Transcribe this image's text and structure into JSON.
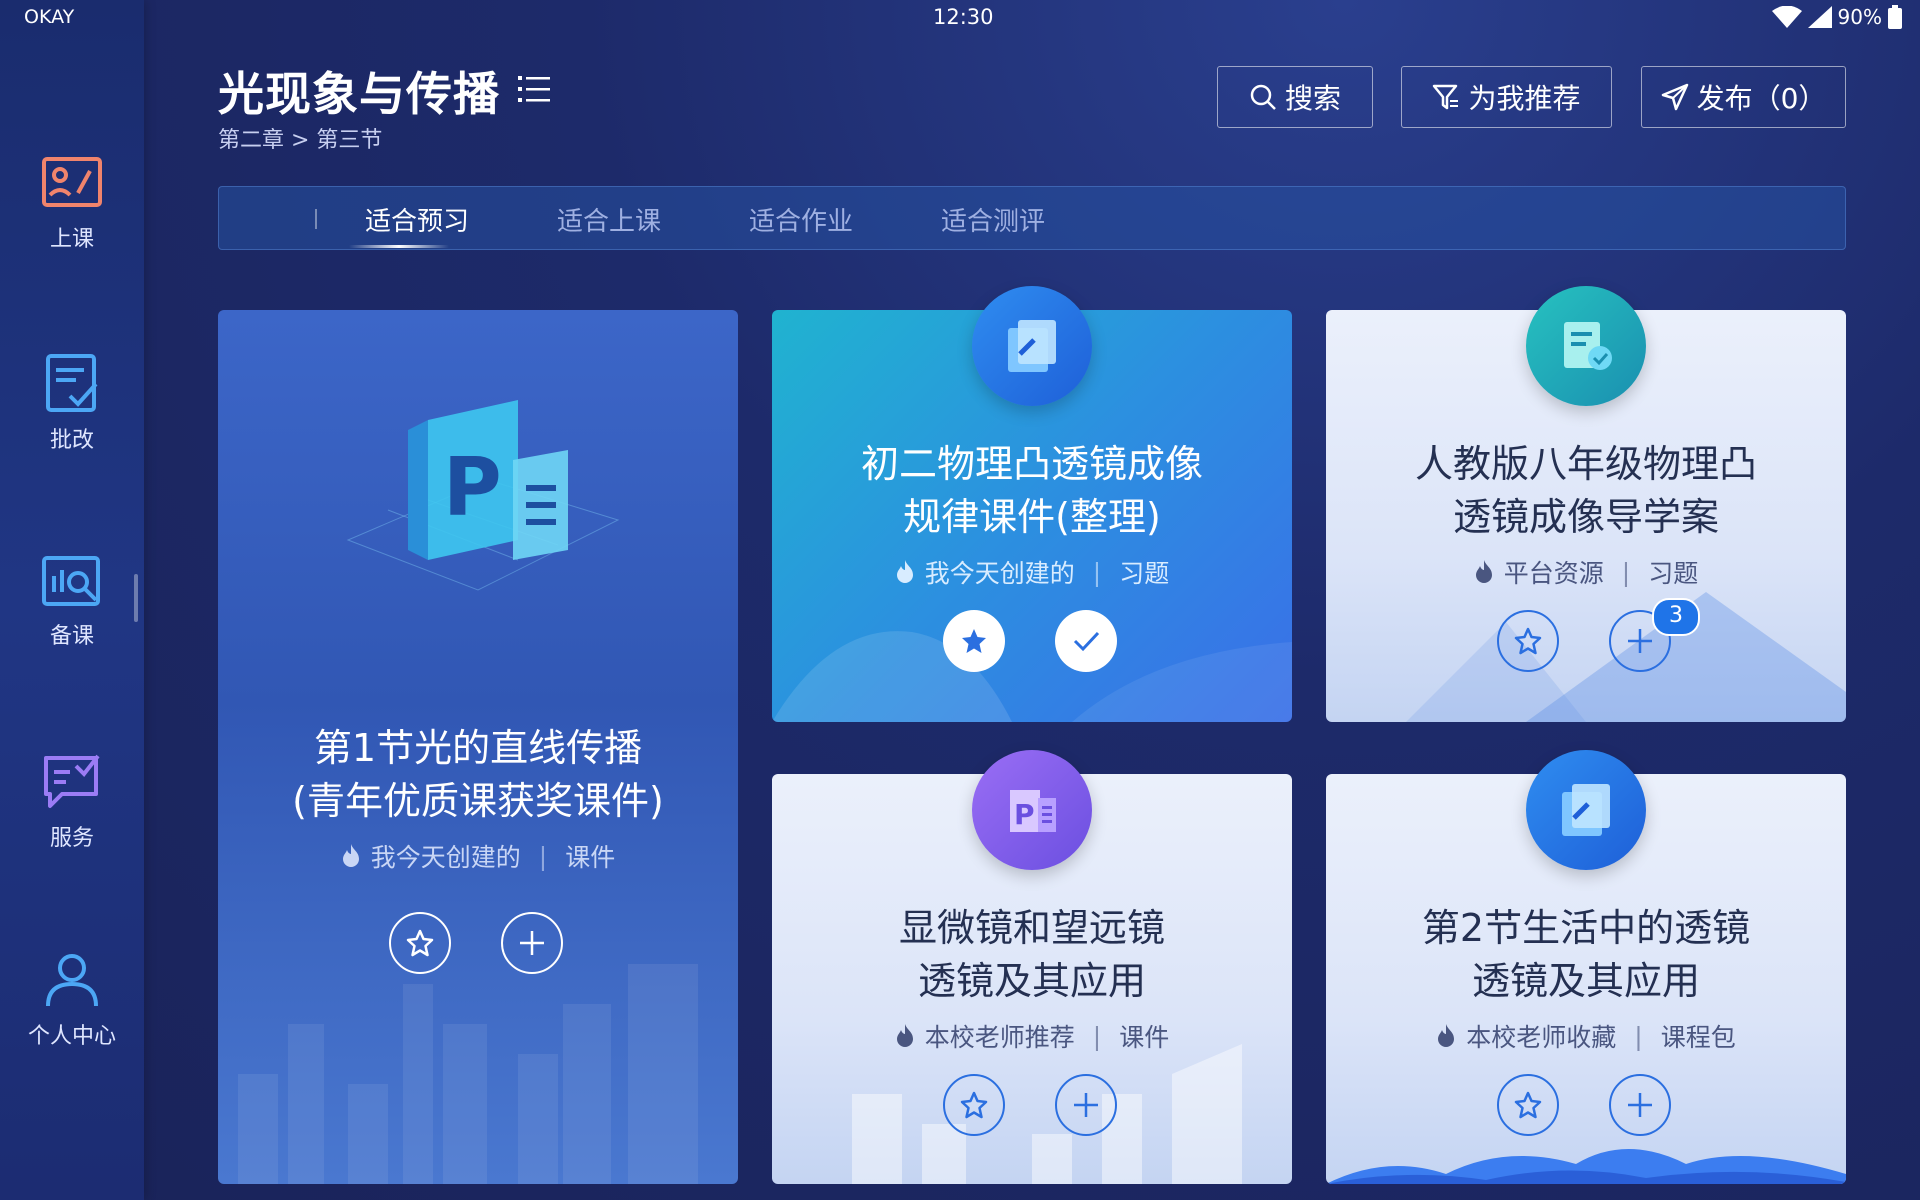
{
  "status_bar": {
    "carrier": "OKAY",
    "time": "12:30",
    "battery": "90%"
  },
  "sidebar": {
    "items": [
      {
        "label": "上课"
      },
      {
        "label": "批改"
      },
      {
        "label": "备课"
      },
      {
        "label": "服务"
      },
      {
        "label": "个人中心"
      }
    ]
  },
  "header": {
    "title": "光现象与传播",
    "breadcrumb": "第二章 > 第三节",
    "search_label": "搜索",
    "recommend_label": "为我推荐",
    "publish_label": "发布（0）"
  },
  "tabs": [
    {
      "label": "适合预习",
      "active": true
    },
    {
      "label": "适合上课",
      "active": false
    },
    {
      "label": "适合作业",
      "active": false
    },
    {
      "label": "适合测评",
      "active": false
    }
  ],
  "cards": [
    {
      "title_line1": "第1节光的直线传播",
      "title_line2": "(青年优质课获奖课件)",
      "source": "我今天创建的",
      "type": "课件",
      "icon": "ppt-document-icon"
    },
    {
      "title_line1": "初二物理凸透镜成像",
      "title_line2": "规律课件(整理)",
      "source": "我今天创建的",
      "type": "习题",
      "icon": "exercise-icon",
      "favorited": true,
      "added": true
    },
    {
      "title_line1": "人教版八年级物理凸",
      "title_line2": "透镜成像导学案",
      "source": "平台资源",
      "type": "习题",
      "icon": "study-guide-icon",
      "badge": "3"
    },
    {
      "title_line1": "显微镜和望远镜",
      "title_line2": "透镜及其应用",
      "source": "本校老师推荐",
      "type": "课件",
      "icon": "ppt-icon"
    },
    {
      "title_line1": "第2节生活中的透镜",
      "title_line2": "透镜及其应用",
      "source": "本校老师收藏",
      "type": "课程包",
      "icon": "course-package-icon"
    }
  ],
  "colors": {
    "accent": "#2b6fe0",
    "background": "#1d2a6a",
    "card_blue": "#2c8fe0",
    "badge": "#1f74e8"
  }
}
